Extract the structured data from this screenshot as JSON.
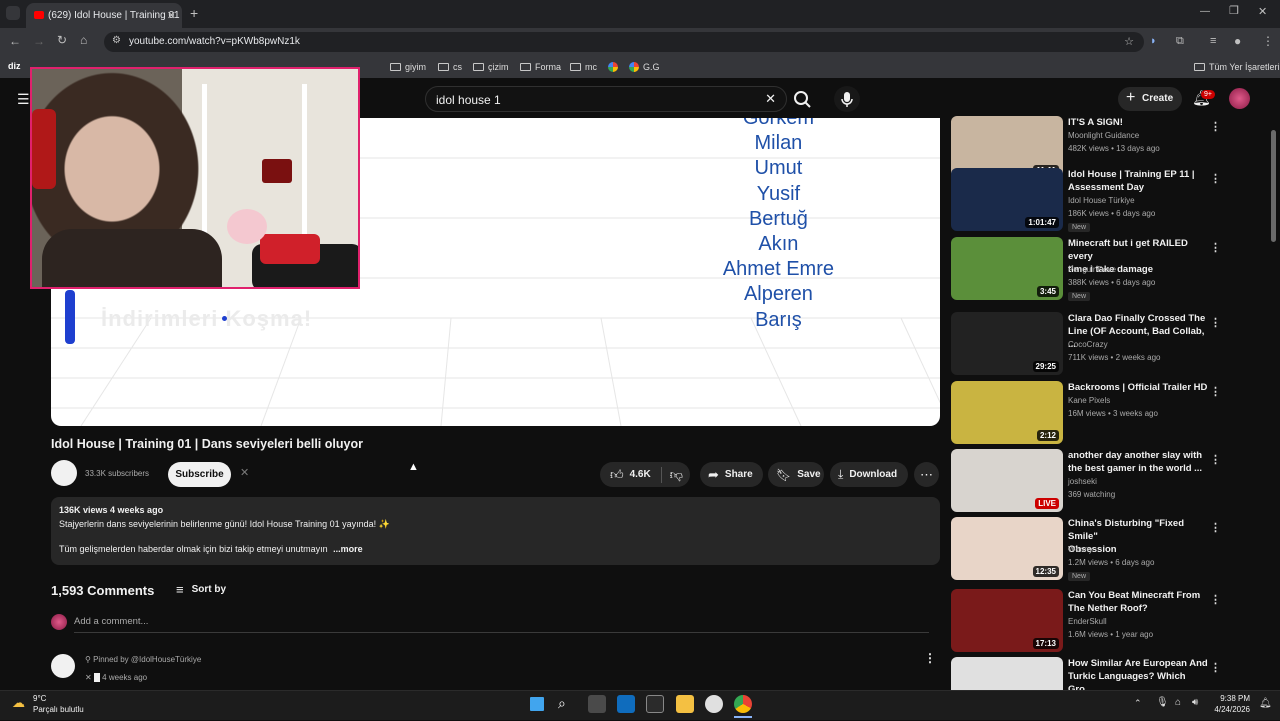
{
  "browser": {
    "tab_title": "(629) Idol House | Training 01 |",
    "url": "youtube.com/watch?v=pKWb8pwNz1k",
    "bookmarks": [
      "giyim",
      "cs",
      "çizim",
      "Forma",
      "mc",
      "G.G"
    ],
    "bookmarks_right": "Tüm Yer İşaretleri",
    "left_label": "diz"
  },
  "yt": {
    "search_query": "idol house  1",
    "create_label": "Create",
    "notif_count": "9+"
  },
  "video": {
    "names": [
      "Görkem",
      "Milan",
      "Umut",
      "Yusif",
      "Bertuğ",
      "Akın",
      "Ahmet Emre",
      "Alperen",
      "Barış"
    ],
    "overlay_text": "İndirimleri Koşma!",
    "title": "Idol House | Training 01 | Dans seviyeleri belli oluyor",
    "subscribers": "33.3K subscribers",
    "subscribe_label": "Subscribe",
    "likes": "4.6K",
    "share_label": "Share",
    "save_label": "Save",
    "download_label": "Download",
    "views_date": "136K views  4 weeks ago",
    "desc_line1": "Stajyerlerin dans seviyelerinin belirlenme günü! Idol House Training 01 yayında! ✨",
    "desc_line2": "Tüm gelişmelerden haberdar olmak için bizi takip etmeyi unutmayın",
    "more_label": "...more"
  },
  "comments": {
    "count": "1,593 Comments",
    "sort_label": "Sort by",
    "add_placeholder": "Add a comment...",
    "pinned_label": "Pinned by @IdolHouseTürkiye",
    "pinned_date": "4 weeks ago"
  },
  "recommendations": [
    {
      "title1": "IT'S A SIGN!",
      "title2": "",
      "channel": "Moonlight Guidance",
      "meta": "482K views • 13 days ago",
      "duration": "11:11",
      "new": "",
      "color": "#c8b5a0"
    },
    {
      "title1": "Idol House | Training EP 11 |",
      "title2": "Assessment Day",
      "channel": "Idol House Türkiye",
      "meta": "186K views • 6 days ago",
      "duration": "1:01:47",
      "new": "New",
      "color": "#1a2a4a"
    },
    {
      "title1": "Minecraft but i get RAILED every",
      "title2": "time i take damage",
      "channel": "PenguinDove",
      "meta": "388K views • 6 days ago",
      "duration": "3:45",
      "new": "New",
      "color": "#5b8f3a"
    },
    {
      "title1": "Clara Dao Finally Crossed The",
      "title2": "Line (OF Account, Bad Collab, ...",
      "channel": "CocoCrazy",
      "meta": "711K views • 2 weeks ago",
      "duration": "29:25",
      "new": "",
      "color": "#222222"
    },
    {
      "title1": "Backrooms | Official Trailer HD",
      "title2": "",
      "channel": "Kane Pixels",
      "meta": "16M views • 3 weeks ago",
      "duration": "2:12",
      "new": "",
      "color": "#c9b441"
    },
    {
      "title1": "another day another slay with",
      "title2": "the best gamer in the world ...",
      "channel": "joshseki",
      "meta": "369 watching",
      "duration": "LIVE",
      "new": "",
      "color": "#d8d4cf"
    },
    {
      "title1": "China's Disturbing \"Fixed Smile\"",
      "title2": "Obsession",
      "channel": "Wonny",
      "meta": "1.2M views • 6 days ago",
      "duration": "12:35",
      "new": "New",
      "color": "#e8d5c8"
    },
    {
      "title1": "Can You Beat Minecraft From",
      "title2": "The Nether Roof?",
      "channel": "EnderSkull",
      "meta": "1.6M views • 1 year ago",
      "duration": "17:13",
      "new": "",
      "color": "#7a1a1a"
    },
    {
      "title1": "How Similar Are European And",
      "title2": "Turkic Languages? Which Gro...",
      "channel": "",
      "meta": "",
      "duration": "",
      "new": "",
      "color": "#e0e0e0"
    }
  ],
  "taskbar": {
    "temp": "9°C",
    "weather": "Parçalı bulutlu",
    "time": "9:38 PM",
    "date": "4/24/2026"
  }
}
